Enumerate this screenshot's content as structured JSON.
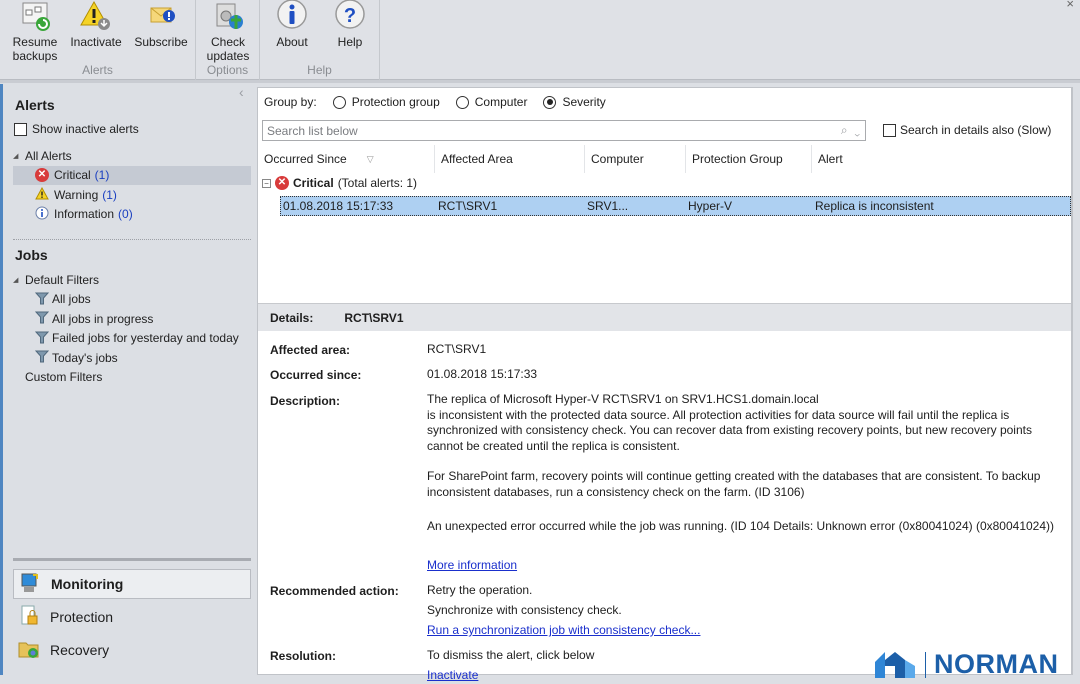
{
  "ribbon": {
    "buttons": [
      {
        "label1": "Resume",
        "label2": "backups",
        "icon": "resume-backups-icon"
      },
      {
        "label1": "Inactivate",
        "label2": "",
        "icon": "inactivate-icon"
      },
      {
        "label1": "Subscribe",
        "label2": "",
        "icon": "subscribe-icon"
      },
      {
        "label1": "Check",
        "label2": "updates",
        "icon": "check-updates-icon"
      },
      {
        "label1": "About",
        "label2": "",
        "icon": "about-icon"
      },
      {
        "label1": "Help",
        "label2": "",
        "icon": "help-icon"
      }
    ],
    "groups": [
      "Alerts",
      "Options",
      "Help"
    ],
    "close_glyph": "×"
  },
  "left": {
    "collapse_glyph": "‹",
    "alerts_title": "Alerts",
    "show_inactive": "Show inactive alerts",
    "all_alerts": "All Alerts",
    "alert_items": [
      {
        "label": "Critical",
        "count": "(1)"
      },
      {
        "label": "Warning",
        "count": "(1)"
      },
      {
        "label": "Information",
        "count": "(0)"
      }
    ],
    "jobs_title": "Jobs",
    "default_filters": "Default Filters",
    "job_items": [
      "All jobs",
      "All jobs in progress",
      "Failed jobs for yesterday and today",
      "Today's jobs"
    ],
    "custom_filters": "Custom Filters",
    "nav": [
      "Monitoring",
      "Protection",
      "Recovery"
    ]
  },
  "main": {
    "group_by_label": "Group by:",
    "group_options": [
      "Protection group",
      "Computer",
      "Severity"
    ],
    "selected_group": "Severity",
    "search_placeholder": "Search list below",
    "search_details": "Search in details also (Slow)",
    "columns": [
      "Occurred Since",
      "Affected Area",
      "Computer",
      "Protection Group",
      "Alert"
    ],
    "group_row": {
      "title": "Critical",
      "suffix": "(Total alerts: 1)"
    },
    "rows": [
      {
        "occurred": "01.08.2018 15:17:33",
        "area": "RCT\\SRV1",
        "computer": "SRV1...",
        "group": "Hyper-V",
        "alert": "Replica is inconsistent"
      }
    ],
    "details": {
      "label": "Details:",
      "title": "RCT\\SRV1",
      "affected_label": "Affected area:",
      "affected": "RCT\\SRV1",
      "occurred_label": "Occurred since:",
      "occurred": "01.08.2018 15:17:33",
      "description_label": "Description:",
      "desc_lines": [
        "The replica of Microsoft Hyper-V RCT\\SRV1 on SRV1.HCS1.domain.local",
        "is inconsistent with the protected data source. All protection activities for data source will fail until the replica is",
        "synchronized with consistency check. You can recover data from existing recovery points, but new recovery points",
        "cannot be created until the replica is consistent."
      ],
      "desc2_lines": [
        "For SharePoint farm, recovery points will continue getting created with the databases that are consistent. To backup",
        "inconsistent databases, run a consistency check on the farm. (ID 3106)"
      ],
      "desc3": "An unexpected error occurred while the job was running. (ID 104 Details: Unknown error (0x80041024) (0x80041024))",
      "more_info": "More information",
      "recommended_label": "Recommended action:",
      "rec1": "Retry the operation.",
      "rec2": "Synchronize with consistency check.",
      "rec_link": "Run a synchronization job with consistency check...",
      "resolution_label": "Resolution:",
      "resolution": "To dismiss the alert, click below",
      "inactivate_link": "Inactivate"
    }
  },
  "brand": {
    "name": "NORMAN",
    "color": "#1c5fa8"
  }
}
